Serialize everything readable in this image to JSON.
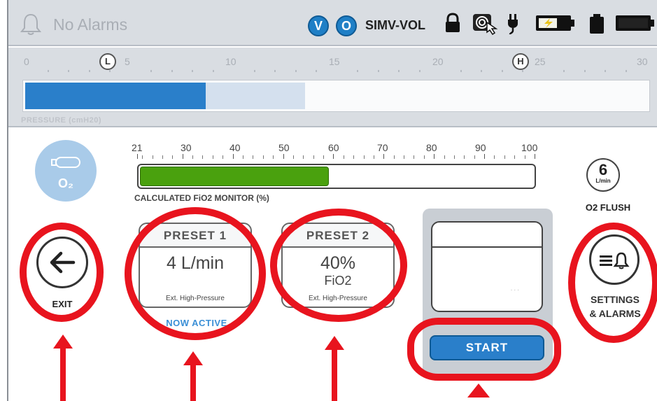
{
  "status_bar": {
    "alarm_text": "No Alarms",
    "mode_v": "V",
    "mode_o": "O",
    "mode_label": "SIMV-VOL",
    "icons": [
      "bell-icon",
      "lock-icon",
      "touch-icon",
      "plug-icon",
      "battery-charging-icon",
      "battery-icon",
      "battery-full-icon"
    ]
  },
  "pressure": {
    "ticks": [
      "0",
      "5",
      "10",
      "15",
      "20",
      "25",
      "30"
    ],
    "low_marker": "L",
    "high_marker": "H",
    "label": "PRESSURE (cmH20)",
    "value_fraction": 0.29,
    "peak_fraction": 0.45,
    "colors": {
      "fill": "#2a7fca",
      "light": "#d4e0ee"
    }
  },
  "fio2": {
    "o2_symbol": "O₂",
    "ticks": [
      "21",
      "30",
      "40",
      "50",
      "60",
      "70",
      "80",
      "90",
      "100"
    ],
    "label": "CALCULATED FiO2 MONITOR (%)",
    "value_fraction": 0.48,
    "color": "#4aa10e"
  },
  "flush": {
    "value": "6",
    "unit": "L/min",
    "label": "O2 FLUSH"
  },
  "exit": {
    "label": "EXIT"
  },
  "preset1": {
    "title": "PRESET 1",
    "value": "4 L/min",
    "footer": "Ext. High-Pressure",
    "status": "NOW ACTIVE"
  },
  "preset2": {
    "title": "PRESET 2",
    "value": "40%",
    "sub": "FiO2",
    "footer": "Ext. High-Pressure"
  },
  "start": {
    "label": "START",
    "dots": "..."
  },
  "settings": {
    "label_line1": "SETTINGS",
    "label_line2": "& ALARMS"
  },
  "annotation_color": "#e8141e"
}
